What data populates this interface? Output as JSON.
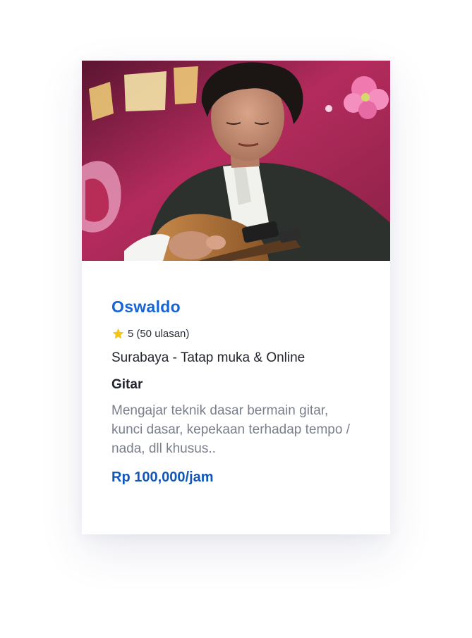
{
  "tutor": {
    "name": "Oswaldo",
    "rating": "5",
    "reviews": "(50 ulasan)",
    "location": "Surabaya - Tatap muka & Online",
    "subject": "Gitar",
    "description": "Mengajar teknik dasar bermain gitar, kunci dasar, kepekaan terhadap tempo / nada, dll khusus..",
    "price": "Rp 100,000/jam",
    "photo": "guitarist-photo"
  },
  "colors": {
    "name": "#1565d8",
    "price": "#1257b8",
    "star": "#f5c518",
    "description": "#7a7f8c"
  }
}
